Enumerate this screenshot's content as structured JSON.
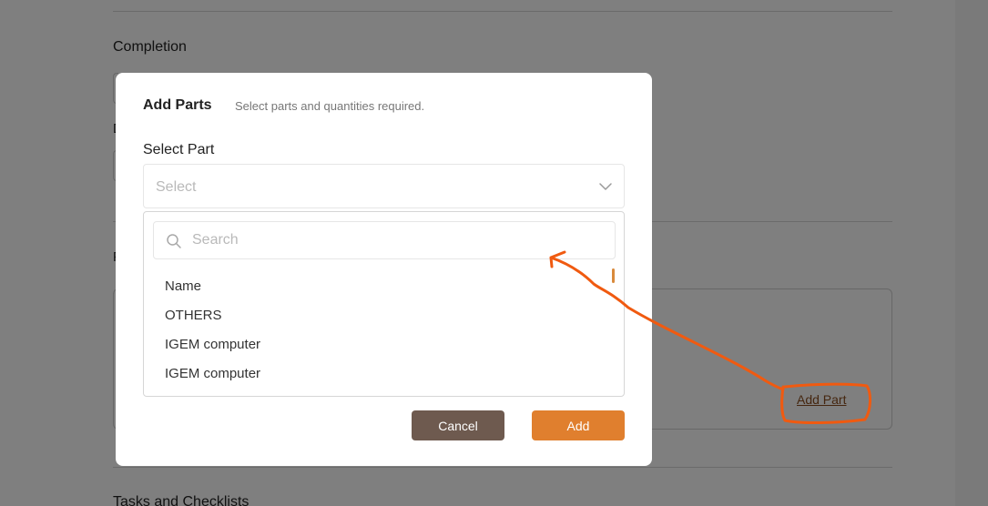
{
  "background": {
    "section_completion": "Completion",
    "section_tasks": "Tasks and Checklists",
    "add_part_link": "Add Part"
  },
  "modal": {
    "title": "Add Parts",
    "subtitle": "Select parts and quantities required.",
    "select_label": "Select Part",
    "select_placeholder": "Select",
    "search_placeholder": "Search",
    "options": [
      "Name",
      "OTHERS",
      "IGEM computer",
      "IGEM computer"
    ],
    "cancel_label": "Cancel",
    "add_label": "Add"
  },
  "colors": {
    "accent": "#e07f2e",
    "cancel": "#6e5a4f",
    "annotation": "#f05a10"
  }
}
